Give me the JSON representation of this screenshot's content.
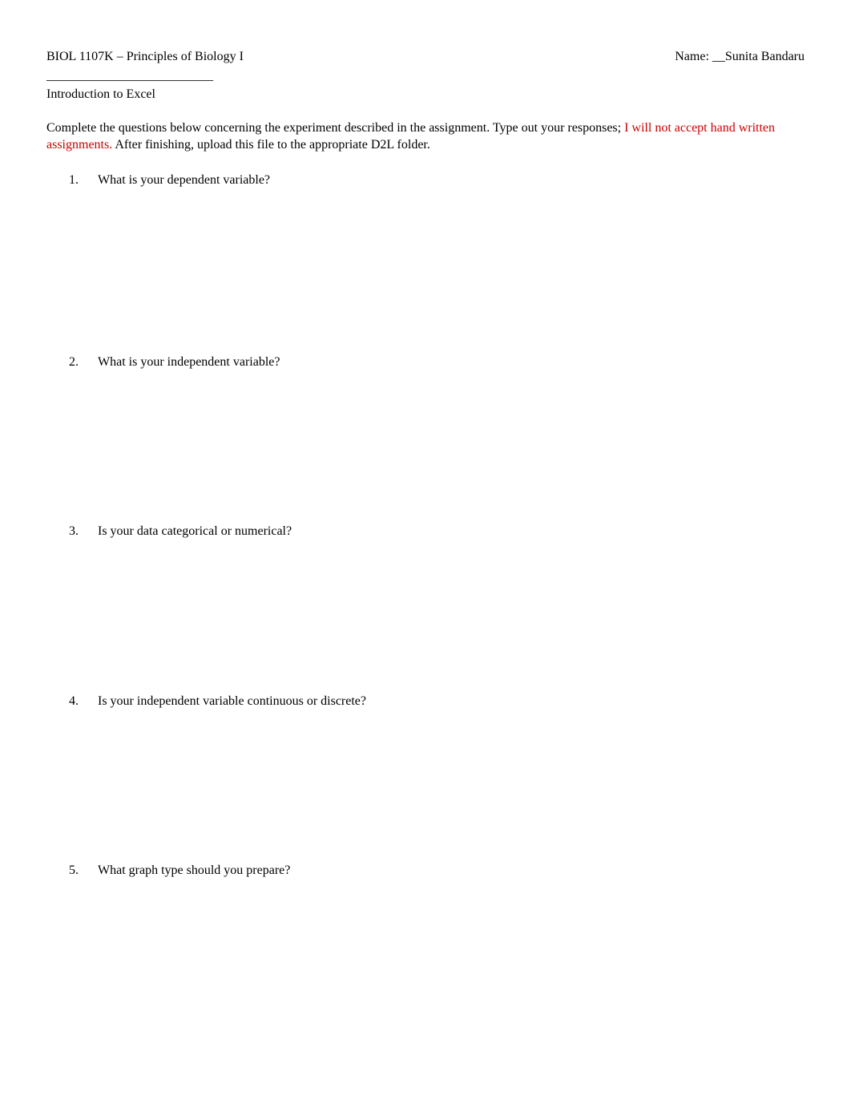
{
  "header": {
    "course_title": "BIOL 1107K – Principles of Biology I",
    "name_label": "Name: __",
    "name_value": "Sunita Bandaru",
    "underline": "__________________________",
    "subtitle": "Introduction to Excel"
  },
  "instructions": {
    "part1": "Complete the questions below concerning the experiment described in the assignment.  Type out your responses; ",
    "red_part": "I will not accept hand written assignments.",
    "part2": "  After finishing, upload this file to the appropriate D2L folder."
  },
  "questions": [
    {
      "number": "1.",
      "text": "What is your dependent variable?"
    },
    {
      "number": "2.",
      "text": "What is your independent variable?"
    },
    {
      "number": "3.",
      "text": "Is your data categorical or numerical?"
    },
    {
      "number": "4.",
      "text": "Is your independent variable continuous or discrete?"
    },
    {
      "number": "5.",
      "text": "What graph type should you prepare?"
    }
  ]
}
